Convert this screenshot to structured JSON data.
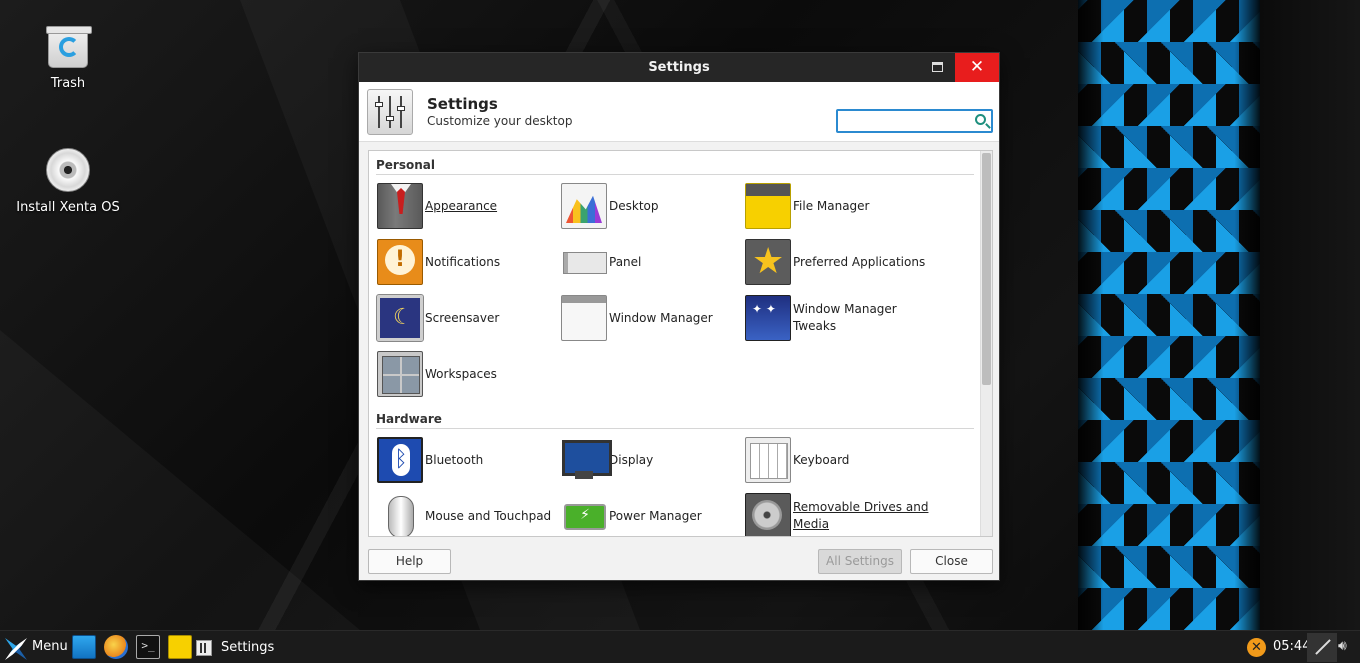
{
  "desktop": {
    "icons": [
      {
        "label": "Trash"
      },
      {
        "label": "Install Xenta OS"
      }
    ]
  },
  "window": {
    "title": "Settings",
    "header": {
      "title": "Settings",
      "subtitle": "Customize your desktop"
    },
    "search": {
      "value": "",
      "placeholder": ""
    },
    "sections": [
      {
        "title": "Personal",
        "items": [
          {
            "label": "Appearance",
            "icon": "appearance-icon"
          },
          {
            "label": "Desktop",
            "icon": "desktop-icon"
          },
          {
            "label": "File Manager",
            "icon": "file-manager-icon"
          },
          {
            "label": "Notifications",
            "icon": "notifications-icon"
          },
          {
            "label": "Panel",
            "icon": "panel-icon"
          },
          {
            "label": "Preferred Applications",
            "icon": "preferred-applications-icon"
          },
          {
            "label": "Screensaver",
            "icon": "screensaver-icon"
          },
          {
            "label": "Window Manager",
            "icon": "window-manager-icon"
          },
          {
            "label": "Window Manager Tweaks",
            "icon": "window-manager-tweaks-icon"
          },
          {
            "label": "Workspaces",
            "icon": "workspaces-icon"
          }
        ]
      },
      {
        "title": "Hardware",
        "items": [
          {
            "label": "Bluetooth",
            "icon": "bluetooth-icon"
          },
          {
            "label": "Display",
            "icon": "display-icon"
          },
          {
            "label": "Keyboard",
            "icon": "keyboard-icon"
          },
          {
            "label": "Mouse and Touchpad",
            "icon": "mouse-icon"
          },
          {
            "label": "Power Manager",
            "icon": "power-manager-icon"
          },
          {
            "label": "Removable Drives and Media",
            "icon": "removable-drives-icon"
          }
        ]
      }
    ],
    "buttons": {
      "help": "Help",
      "all_settings": "All Settings",
      "close": "Close"
    },
    "colors": {
      "titlebar": "#262626",
      "close": "#e81d1d",
      "search_border": "#2b8ad0"
    }
  },
  "taskbar": {
    "menu_label": "Menu",
    "task_label": "Settings",
    "clock": "05:44",
    "tray_warning": "✕"
  }
}
